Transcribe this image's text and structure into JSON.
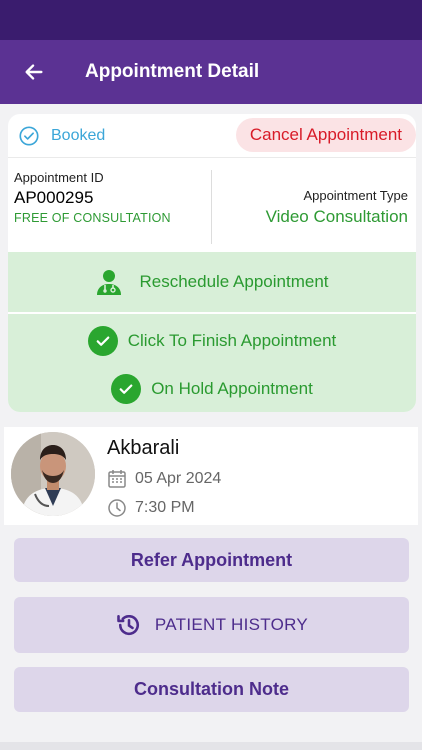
{
  "header": {
    "title": "Appointment Detail",
    "back_icon": "arrow-left-icon",
    "bar_color": "#5b3293",
    "status_bar_color": "#3a1c6e"
  },
  "appointment": {
    "status": "Booked",
    "cancel_label": "Cancel Appointment",
    "id_label": "Appointment ID",
    "id_value": "AP000295",
    "fee_note": "FREE OF CONSULTATION",
    "type_label": "Appointment Type",
    "type_value": "Video Consultation"
  },
  "actions": {
    "reschedule_label": "Reschedule Appointment",
    "finish_label": "Click To Finish Appointment",
    "hold_label": "On Hold Appointment",
    "accent_color": "#2a9a30",
    "panel_color": "#d8efd8"
  },
  "doctor": {
    "name": "Akbarali",
    "date": "05 Apr 2024",
    "time": "7:30 PM"
  },
  "buttons": {
    "refer_label": "Refer Appointment",
    "history_label": "PATIENT HISTORY",
    "consultation_label": "Consultation Note",
    "color": "#ddd6ea",
    "text_color": "#4d2c8c"
  }
}
